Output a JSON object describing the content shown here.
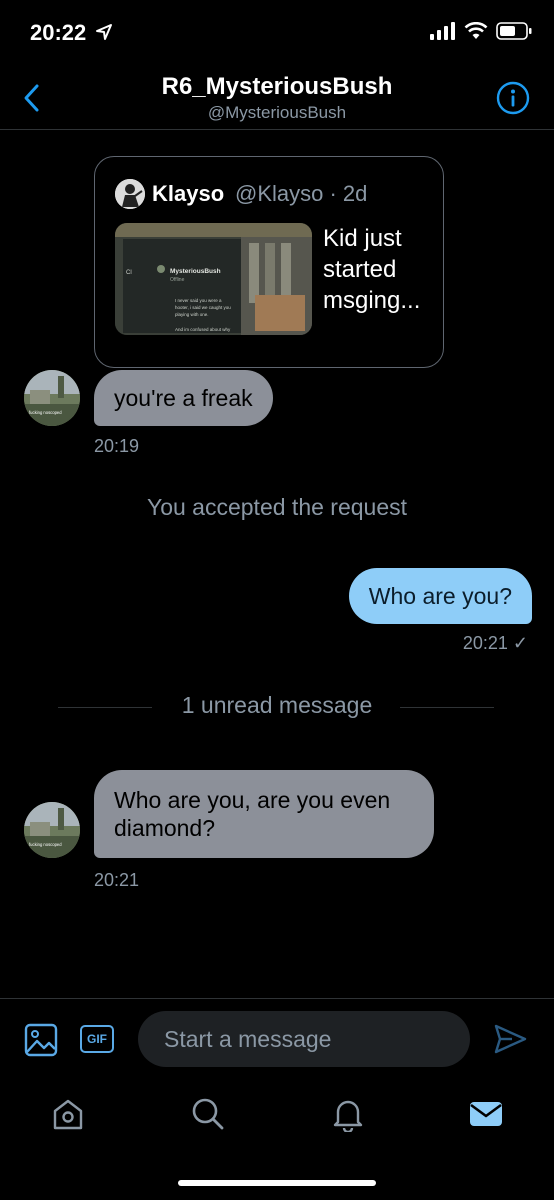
{
  "status_bar": {
    "time": "20:22"
  },
  "header": {
    "title": "R6_MysteriousBush",
    "handle": "@MysteriousBush"
  },
  "quote": {
    "name": "Klayso",
    "handle_time": "@Klayso · 2d",
    "text": "Kid just started msging...",
    "preview": {
      "name": "MysteriousBush",
      "status": "Offline",
      "cl": "Cl",
      "line1": "I never said you were a",
      "line2": "hooter, i said we caught you",
      "line3": "playing with one.",
      "line4": "And im confused about why"
    }
  },
  "avatar_caption": "fucking noscoped",
  "messages": [
    {
      "text": "you're a freak",
      "time": "20:19"
    },
    {
      "text": "Who are you?",
      "time": "20:21 ✓"
    },
    {
      "text": "Who are you, are you even diamond?",
      "time": "20:21"
    }
  ],
  "system_message": "You accepted the request",
  "unread_label": "1 unread message",
  "composer": {
    "placeholder": "Start a message",
    "gif_label": "GIF"
  },
  "colors": {
    "accent": "#1d9bf0",
    "incoming_bubble": "#8c9099",
    "outgoing_bubble": "#8ecdf8"
  },
  "icons": {
    "status": [
      "location-arrow-icon",
      "signal-icon",
      "wifi-icon",
      "battery-icon"
    ],
    "header": [
      "back-chevron-icon",
      "info-icon"
    ],
    "composer": [
      "image-icon",
      "gif-icon",
      "send-icon"
    ],
    "tabs": [
      "home-icon",
      "search-icon",
      "notifications-icon",
      "messages-icon"
    ]
  }
}
